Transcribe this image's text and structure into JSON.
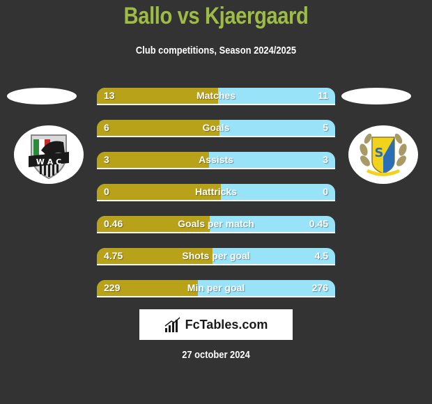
{
  "header": {
    "title": "Ballo vs Kjaergaard",
    "subtitle": "Club competitions, Season 2024/2025"
  },
  "colors": {
    "background": "#333333",
    "title": "#9dbb45",
    "left_bar": "#b8a21a",
    "right_bar": "#98e3f8"
  },
  "players": {
    "left": {
      "name": "Ballo",
      "club_logo": "wac-crest-icon"
    },
    "right": {
      "name": "Kjaergaard",
      "club_logo": "laurel-shield-crest-icon"
    }
  },
  "stats": [
    {
      "label": "Matches",
      "left": "13",
      "right": "11",
      "left_share": 0.51
    },
    {
      "label": "Goals",
      "left": "6",
      "right": "5",
      "left_share": 0.515
    },
    {
      "label": "Assists",
      "left": "3",
      "right": "3",
      "left_share": 0.47
    },
    {
      "label": "Hattricks",
      "left": "0",
      "right": "0",
      "left_share": 0.52
    },
    {
      "label": "Goals per match",
      "left": "0.46",
      "right": "0.45",
      "left_share": 0.475
    },
    {
      "label": "Shots per goal",
      "left": "4.75",
      "right": "4.5",
      "left_share": 0.485
    },
    {
      "label": "Min per goal",
      "left": "229",
      "right": "276",
      "left_share": 0.425
    }
  ],
  "footer": {
    "brand": "FcTables.com",
    "date": "27 october 2024"
  }
}
